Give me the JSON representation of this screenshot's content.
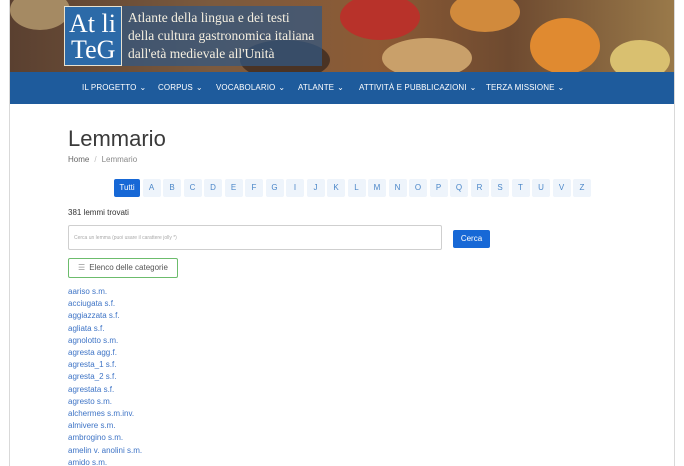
{
  "logo": {
    "line1": "At li",
    "line2": "TeG"
  },
  "site_title": {
    "line1": "Atlante della lingua e dei testi",
    "line2": "della cultura gastronomica italiana",
    "line3": "dall'età medievale all'Unità"
  },
  "nav": [
    {
      "label": "IL PROGETTO"
    },
    {
      "label": "CORPUS"
    },
    {
      "label": "VOCABOLARIO"
    },
    {
      "label": "ATLANTE"
    },
    {
      "label": "ATTIVITÀ E PUBBLICAZIONI"
    },
    {
      "label": "TERZA MISSIONE"
    }
  ],
  "icons": {
    "caret": "chevron-down-icon",
    "categories": "list-icon"
  },
  "page": {
    "title": "Lemmario"
  },
  "breadcrumb": {
    "home": "Home",
    "separator": "/",
    "current": "Lemmario"
  },
  "letters": [
    "Tutti",
    "A",
    "B",
    "C",
    "D",
    "E",
    "F",
    "G",
    "I",
    "J",
    "K",
    "L",
    "M",
    "N",
    "O",
    "P",
    "Q",
    "R",
    "S",
    "T",
    "U",
    "V",
    "Z"
  ],
  "active_letter": "Tutti",
  "results": {
    "count_text": "381 lemmi trovati"
  },
  "search": {
    "placeholder": "Cerca un lemma (puoi usare il carattere jolly *)",
    "button": "Cerca"
  },
  "categories_button": "Elenco delle categorie",
  "lemmas": [
    "aariso s.m.",
    "acciugata s.f.",
    "aggiazzata s.f.",
    "agliata s.f.",
    "agnolotto s.m.",
    "agresta agg.f.",
    "agresta_1 s.f.",
    "agresta_2 s.f.",
    "agrestata s.f.",
    "agresto s.m.",
    "alchermes s.m.inv.",
    "almivere s.m.",
    "ambrogino s.m.",
    "amelin v. anolini s.m.",
    "amido s.m."
  ],
  "colors": {
    "nav": "#1e5b9c",
    "accent": "#1768d6",
    "link": "#3e74c6",
    "category_border": "#6cbc6c"
  }
}
